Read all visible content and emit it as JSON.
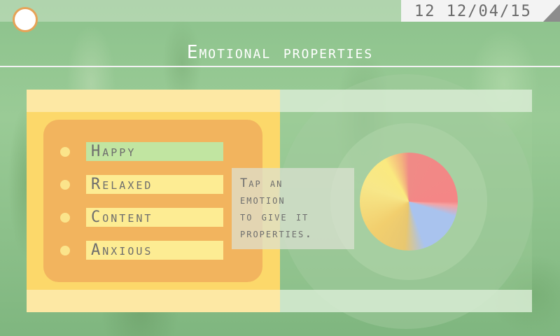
{
  "header": {
    "status_text": "12 12/04/15",
    "title": "Emotional properties"
  },
  "emotions": [
    {
      "label": "Happy",
      "selected": true
    },
    {
      "label": "Relaxed",
      "selected": false
    },
    {
      "label": "Content",
      "selected": false
    },
    {
      "label": "Anxious",
      "selected": false
    }
  ],
  "hint": {
    "text": "Tap an\nemotion\nto give it\nproperties."
  },
  "icons": {
    "home": "home-ring-icon",
    "bullet": "bullet-dot-icon"
  },
  "colors": {
    "accent": "#e6a357",
    "panel_yellow": "#fcd86a",
    "emotion_box": "#f2b45e",
    "selected_green": "#c1e5a1",
    "button_yellow": "#fdec93",
    "pie_red": "#f48686",
    "pie_blue": "#a9c3ee",
    "pie_yellow": "#f7e789"
  }
}
